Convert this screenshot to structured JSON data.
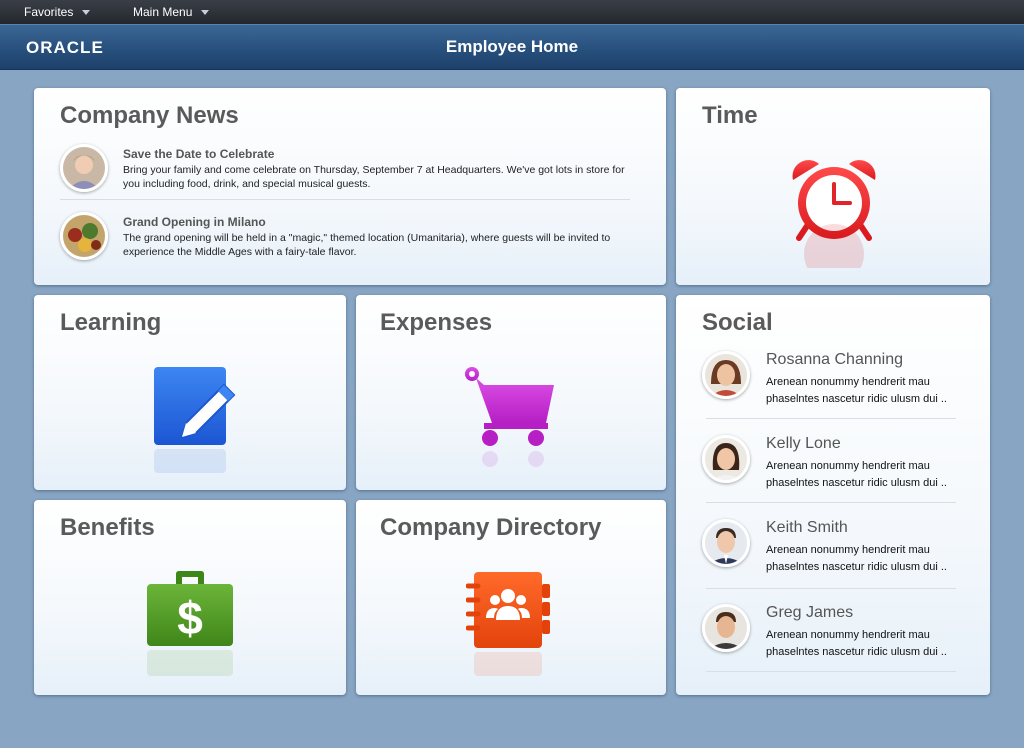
{
  "menubar": {
    "favorites_label": "Favorites",
    "main_menu_label": "Main Menu"
  },
  "header": {
    "brand": "ORACLE",
    "title": "Employee Home"
  },
  "tiles": {
    "company_news": {
      "title": "Company News",
      "items": [
        {
          "headline": "Save the Date to Celebrate",
          "body": "Bring your family and come celebrate on Thursday, September 7 at Headquarters. We've got lots in store for you including food, drink, and special musical guests."
        },
        {
          "headline": "Grand Opening in Milano",
          "body": "The grand opening will be held in a \"magic,\" themed location (Umanitaria), where guests will be invited to experience the Middle Ages with a fairy-tale flavor."
        }
      ]
    },
    "time": {
      "title": "Time",
      "icon": "alarm-clock-icon",
      "color": "#e8262b"
    },
    "learning": {
      "title": "Learning",
      "icon": "pencil-note-icon",
      "color": "#2f6fe0"
    },
    "expenses": {
      "title": "Expenses",
      "icon": "shopping-cart-icon",
      "color": "#c12bd0"
    },
    "benefits": {
      "title": "Benefits",
      "icon": "dollar-briefcase-icon",
      "color": "#4e9a23"
    },
    "company_directory": {
      "title": "Company Directory",
      "icon": "address-book-icon",
      "color": "#f04d10"
    },
    "social": {
      "title": "Social",
      "people": [
        {
          "name": "Rosanna Channing",
          "line1": "Arenean nonummy hendrerit mau",
          "line2": "phaselntes nascetur ridic ulusm dui .."
        },
        {
          "name": "Kelly Lone",
          "line1": "Arenean nonummy hendrerit mau",
          "line2": "phaselntes nascetur ridic ulusm dui .."
        },
        {
          "name": "Keith Smith",
          "line1": "Arenean nonummy hendrerit mau",
          "line2": "phaselntes nascetur ridic ulusm dui .."
        },
        {
          "name": "Greg James",
          "line1": "Arenean nonummy hendrerit mau",
          "line2": "phaselntes nascetur ridic ulusm dui .."
        }
      ]
    }
  }
}
